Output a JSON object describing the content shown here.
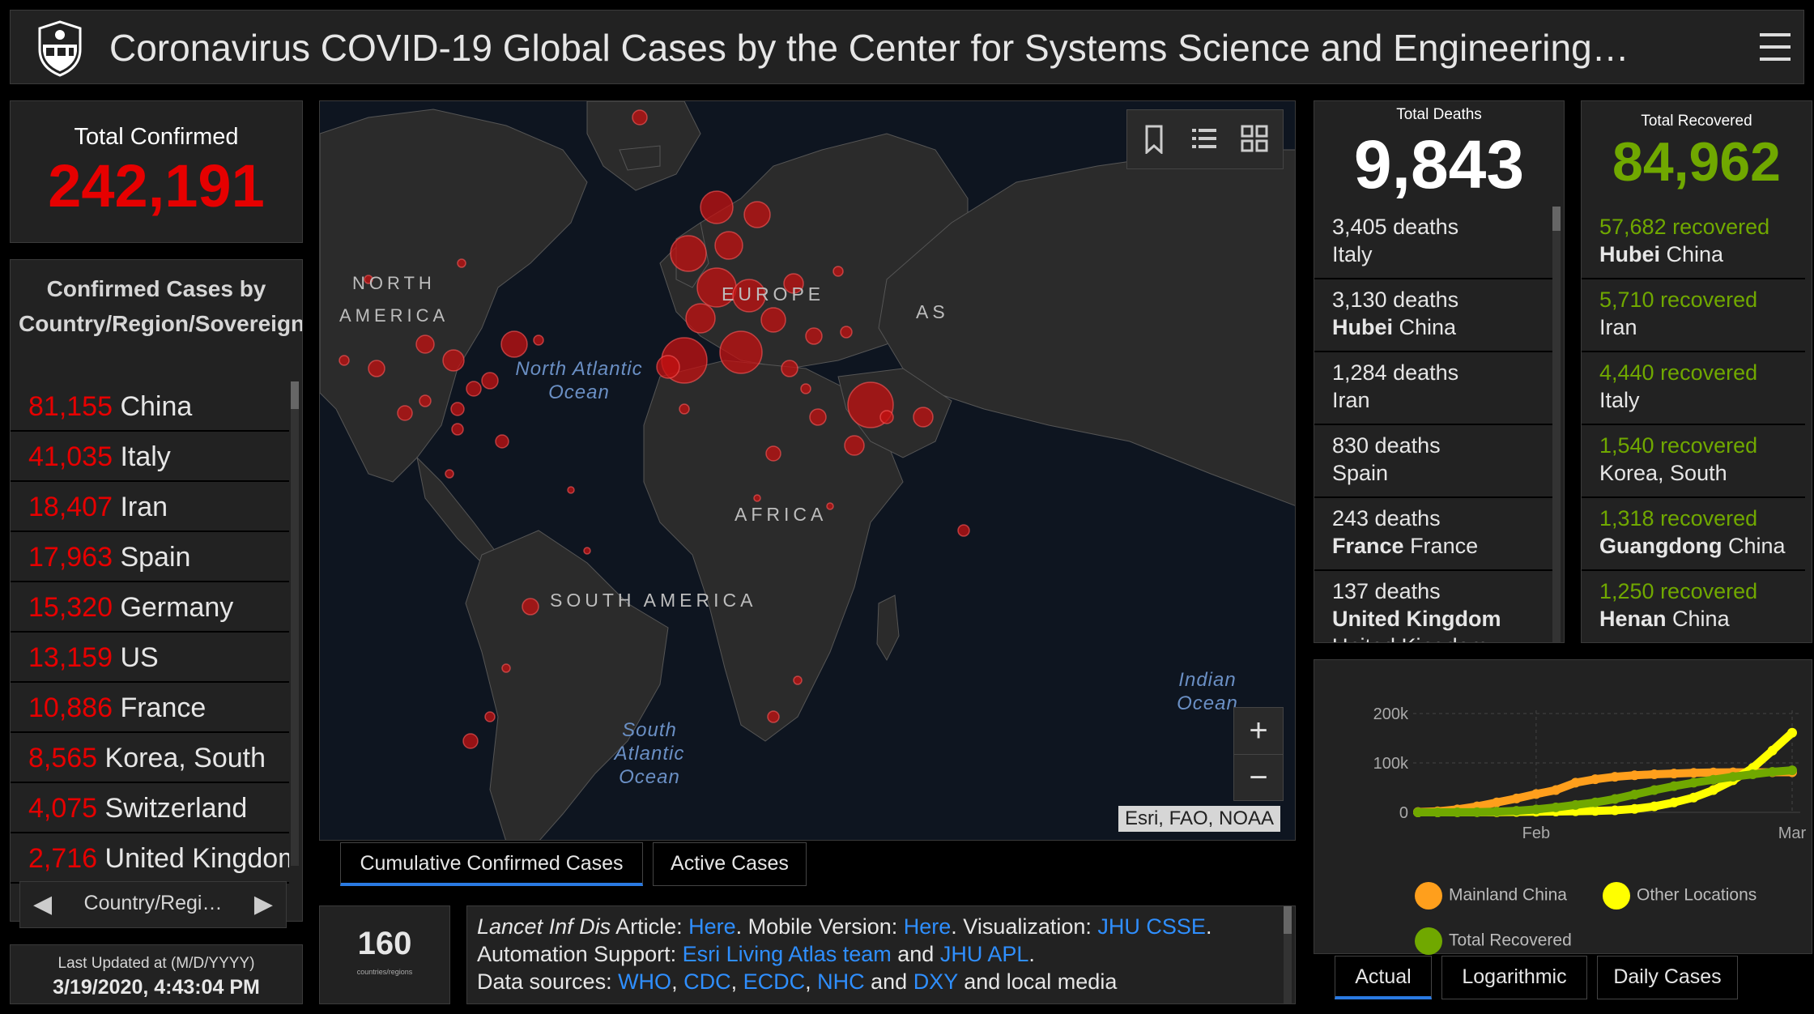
{
  "header": {
    "title": "Coronavirus COVID-19 Global Cases by the Center for Systems Science and Engineering…",
    "logo_icon": "university-shield-icon",
    "menu_icon": "hamburger-menu-icon"
  },
  "total_confirmed": {
    "label": "Total Confirmed",
    "value": "242,191"
  },
  "confirmed_by_country": {
    "header": "Confirmed Cases by Country/Region/Sovereignty",
    "rows": [
      {
        "value": "81,155",
        "name": "China"
      },
      {
        "value": "41,035",
        "name": "Italy"
      },
      {
        "value": "18,407",
        "name": "Iran"
      },
      {
        "value": "17,963",
        "name": "Spain"
      },
      {
        "value": "15,320",
        "name": "Germany"
      },
      {
        "value": "13,159",
        "name": "US"
      },
      {
        "value": "10,886",
        "name": "France"
      },
      {
        "value": "8,565",
        "name": "Korea, South"
      },
      {
        "value": "4,075",
        "name": "Switzerland"
      },
      {
        "value": "2,716",
        "name": "United Kingdom"
      }
    ],
    "pager_label": "Country/Regi…"
  },
  "last_updated": {
    "label": "Last Updated at (M/D/YYYY)",
    "value": "3/19/2020, 4:43:04 PM"
  },
  "map": {
    "labels": {
      "north_america": "NORTH AMERICA",
      "south_america": "SOUTH AMERICA",
      "europe": "EUROPE",
      "africa": "AFRICA",
      "asia": "AS",
      "north_atlantic": "North Atlantic Ocean",
      "south_atlantic": "South Atlantic Ocean",
      "indian": "Indian Ocean"
    },
    "attribution": "Esri, FAO, NOAA",
    "zoom_in": "+",
    "zoom_out": "−",
    "tools": [
      "bookmark-icon",
      "list-icon",
      "qr-grid-icon"
    ],
    "tabs": [
      "Cumulative Confirmed Cases",
      "Active Cases"
    ],
    "active_tab": "Cumulative Confirmed Cases"
  },
  "country_count": {
    "value": "160",
    "label": "countries/regions"
  },
  "info": {
    "line1_pre": "Lancet Inf Dis",
    "line1_a": " Article: ",
    "line1_link1": "Here",
    "line1_b": ". Mobile Version: ",
    "line1_link2": "Here",
    "line1_c": ". Visualization: ",
    "line1_link3": "JHU CSSE",
    "line1_d": ".",
    "line2_a": "Automation Support: ",
    "line2_link1": "Esri Living Atlas team",
    "line2_b": " and ",
    "line2_link2": "JHU APL",
    "line2_c": ".",
    "line3_a": "Data sources: ",
    "line3_link1": "WHO",
    "line3_link2": "CDC",
    "line3_link3": "ECDC",
    "line3_link4": "NHC",
    "line3_link5": "DXY",
    "line3_b": " and local media",
    "sep": ", ",
    "and": " and "
  },
  "deaths": {
    "label": "Total Deaths",
    "value": "9,843",
    "rows": [
      {
        "value": "3,405 deaths",
        "bold": "",
        "place": "Italy"
      },
      {
        "value": "3,130 deaths",
        "bold": "Hubei",
        "place": "China"
      },
      {
        "value": "1,284 deaths",
        "bold": "",
        "place": "Iran"
      },
      {
        "value": "830 deaths",
        "bold": "",
        "place": "Spain"
      },
      {
        "value": "243 deaths",
        "bold": "France",
        "place": "France"
      },
      {
        "value": "137 deaths",
        "bold": "United Kingdom",
        "place": "United Kingdom"
      }
    ]
  },
  "recovered": {
    "label": "Total Recovered",
    "value": "84,962",
    "rows": [
      {
        "value": "57,682 recovered",
        "bold": "Hubei",
        "place": "China"
      },
      {
        "value": "5,710 recovered",
        "bold": "",
        "place": "Iran"
      },
      {
        "value": "4,440 recovered",
        "bold": "",
        "place": "Italy"
      },
      {
        "value": "1,540 recovered",
        "bold": "",
        "place": "Korea, South"
      },
      {
        "value": "1,318 recovered",
        "bold": "Guangdong",
        "place": "China"
      },
      {
        "value": "1,250 recovered",
        "bold": "Henan",
        "place": "China"
      }
    ]
  },
  "chart_tabs": [
    "Actual",
    "Logarithmic",
    "Daily Cases"
  ],
  "active_chart_tab": "Actual",
  "colors": {
    "confirmed_red": "#e60000",
    "recovered_green": "#70a800",
    "mainland_china": "#ff9f1c",
    "other_locations": "#ffff00",
    "total_recovered": "#70a800",
    "link_blue": "#2f8fff"
  },
  "chart_data": {
    "type": "line",
    "title": "",
    "xlabel": "",
    "ylabel": "",
    "x_ticks": [
      "Feb",
      "Mar"
    ],
    "y_ticks": [
      "0",
      "100k",
      "200k"
    ],
    "ylim": [
      0,
      200000
    ],
    "series": [
      {
        "name": "Mainland China",
        "color": "#ff9f1c",
        "values": [
          555,
          2000,
          6000,
          12000,
          20000,
          28000,
          37000,
          45000,
          60000,
          67000,
          72000,
          75000,
          77000,
          78500,
          80000,
          80700,
          80900,
          81000,
          81100,
          81155
        ]
      },
      {
        "name": "Other Locations",
        "color": "#ffff00",
        "values": [
          0,
          50,
          150,
          300,
          500,
          800,
          1200,
          1700,
          2200,
          2800,
          4000,
          7000,
          12000,
          20000,
          30000,
          45000,
          65000,
          90000,
          125000,
          161036
        ]
      },
      {
        "name": "Total Recovered",
        "color": "#70a800",
        "values": [
          28,
          50,
          150,
          500,
          1500,
          3000,
          6000,
          10000,
          15000,
          20000,
          27000,
          36000,
          45000,
          53000,
          60000,
          66000,
          72000,
          77000,
          82000,
          84962
        ]
      }
    ],
    "legend": [
      "Mainland China",
      "Other Locations",
      "Total Recovered"
    ]
  }
}
